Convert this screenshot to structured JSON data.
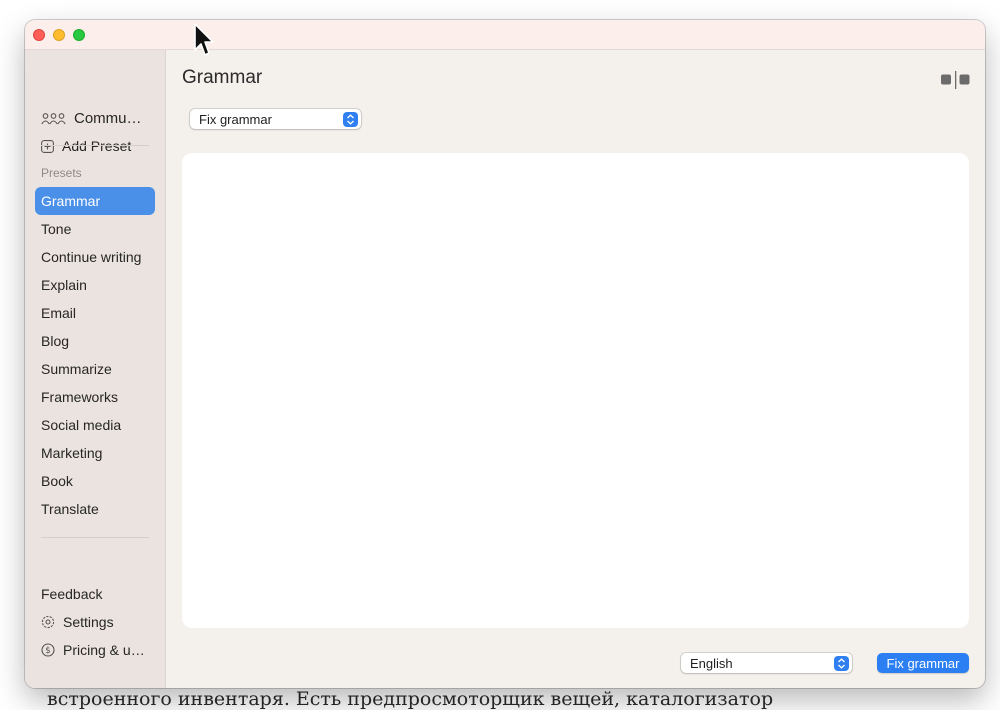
{
  "background_text": "встроенного инвентаря. Есть предпросмоторщик вещей, каталогизатор",
  "sidebar": {
    "top_items": [
      {
        "label": "Commu…",
        "icon": "people-icon"
      },
      {
        "label": "Add Preset",
        "icon": "plus-square-icon"
      }
    ],
    "section_label": "Presets",
    "presets": [
      "Grammar",
      "Tone",
      "Continue writing",
      "Explain",
      "Email",
      "Blog",
      "Summarize",
      "Frameworks",
      "Social media",
      "Marketing",
      "Book",
      "Translate"
    ],
    "active_preset": "Grammar",
    "bottom_items": [
      {
        "label": "Feedback",
        "icon": ""
      },
      {
        "label": "Settings",
        "icon": "gear-icon"
      },
      {
        "label": "Pricing & u…",
        "icon": "dollar-circle-icon"
      }
    ]
  },
  "main": {
    "title": "Grammar",
    "preset_select": {
      "value": "Fix grammar"
    },
    "editor_text": "",
    "language_select": {
      "value": "English"
    },
    "action_button": "Fix grammar"
  },
  "colors": {
    "accent": "#2b7ff2",
    "active_row": "#4a90e8",
    "sidebar_bg": "#ebe3df",
    "window_bg": "#f4f0ec"
  }
}
